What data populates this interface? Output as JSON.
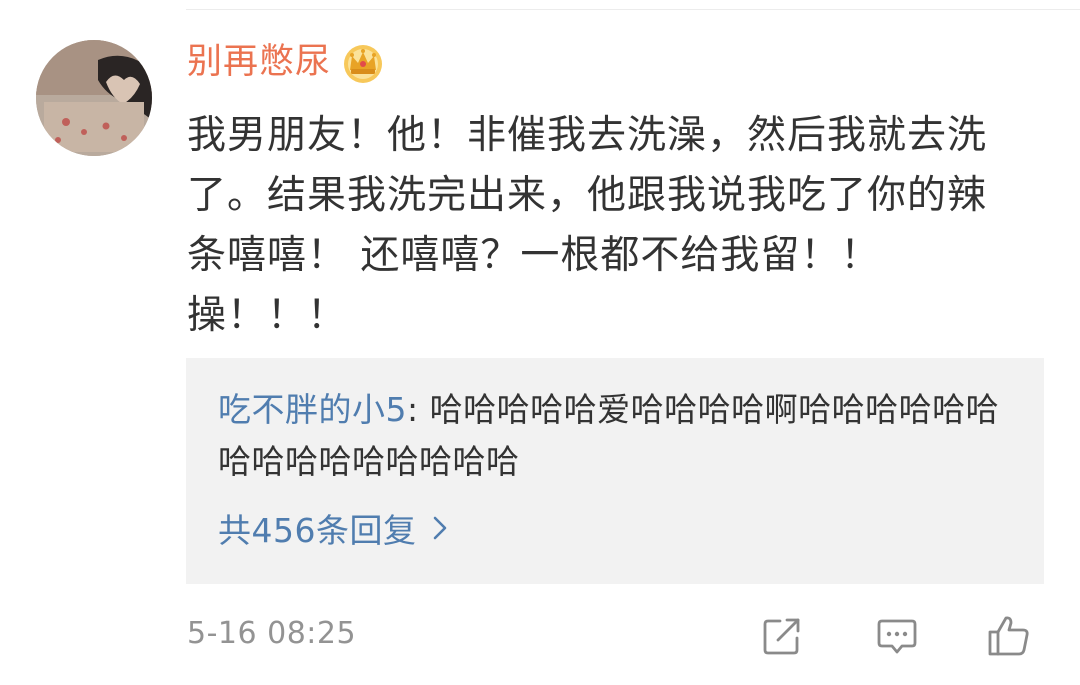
{
  "comment": {
    "username": "别再憋尿",
    "badge_icon": "crown-icon",
    "text": "我男朋友！他！非催我去洗澡，然后我就去洗了。结果我洗完出来，他跟我说我吃了你的辣条嘻嘻！ 还嘻嘻？一根都不给我留！！操！！！",
    "timestamp": "5-16 08:25"
  },
  "reply_preview": {
    "user": "吃不胖的小5",
    "separator": ": ",
    "text": "哈哈哈哈哈爱哈哈哈哈啊哈哈哈哈哈哈哈哈哈哈哈哈哈哈哈",
    "count_label": "共456条回复",
    "chevron_icon": "chevron-right-icon"
  },
  "actions": {
    "share_icon": "share-icon",
    "comment_icon": "comment-icon",
    "like_icon": "thumbs-up-icon"
  },
  "colors": {
    "username": "#eb7350",
    "link": "#507daf",
    "text": "#333333",
    "meta": "#939393",
    "reply_bg": "#f2f2f2"
  }
}
